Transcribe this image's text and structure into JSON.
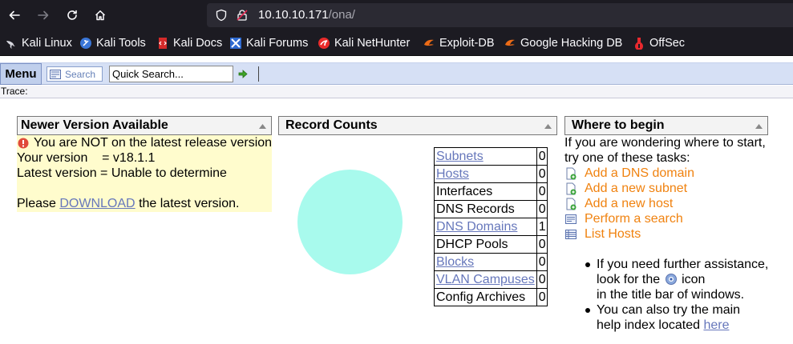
{
  "browser": {
    "url_host": "10.10.10.171",
    "url_path": "/ona/",
    "bookmarks": [
      "Kali Linux",
      "Kali Tools",
      "Kali Docs",
      "Kali Forums",
      "Kali NetHunter",
      "Exploit-DB",
      "Google Hacking DB",
      "OffSec"
    ]
  },
  "menubar": {
    "menu_label": "Menu",
    "search_label": "Search",
    "quick_search_value": "Quick Search...",
    "trace_label": "Trace:"
  },
  "newer_version": {
    "title": "Newer Version Available",
    "warning": "You are NOT on the latest release version",
    "your_version": "Your version    = v18.1.1",
    "latest_version": "Latest version = Unable to determine",
    "please": "Please",
    "download_link": "DOWNLOAD",
    "latest_suffix": "the latest version."
  },
  "record_counts": {
    "title": "Record Counts",
    "rows": [
      {
        "label": "Subnets",
        "count": "0",
        "link": true
      },
      {
        "label": "Hosts",
        "count": "0",
        "link": true
      },
      {
        "label": "Interfaces",
        "count": "0",
        "link": false
      },
      {
        "label": "DNS Records",
        "count": "0",
        "link": false
      },
      {
        "label": "DNS Domains",
        "count": "1",
        "link": true
      },
      {
        "label": "DHCP Pools",
        "count": "0",
        "link": false
      },
      {
        "label": "Blocks",
        "count": "0",
        "link": true
      },
      {
        "label": "VLAN Campuses",
        "count": "0",
        "link": true
      },
      {
        "label": "Config Archives",
        "count": "0",
        "link": false
      }
    ]
  },
  "where_to_begin": {
    "title": "Where to begin",
    "intro_line1": "If you are wondering where to start,",
    "intro_line2": "try one of these tasks:",
    "tasks": [
      "Add a DNS domain",
      "Add a new subnet",
      "Add a new host",
      "Perform a search",
      "List Hosts"
    ],
    "help1_line1": "If you need further assistance,",
    "help1_line2a": "look for the",
    "help1_line2b": "icon",
    "help1_line3": "in the title bar of windows.",
    "help2_line1": "You can also try the main",
    "help2_line2": "help index located",
    "help2_link": "here"
  },
  "colors": {
    "pie_fill": "#a8faed",
    "task_link": "#f0820f",
    "notice_bg": "#fffccd",
    "menubar_bg": "#d6e0f5"
  }
}
